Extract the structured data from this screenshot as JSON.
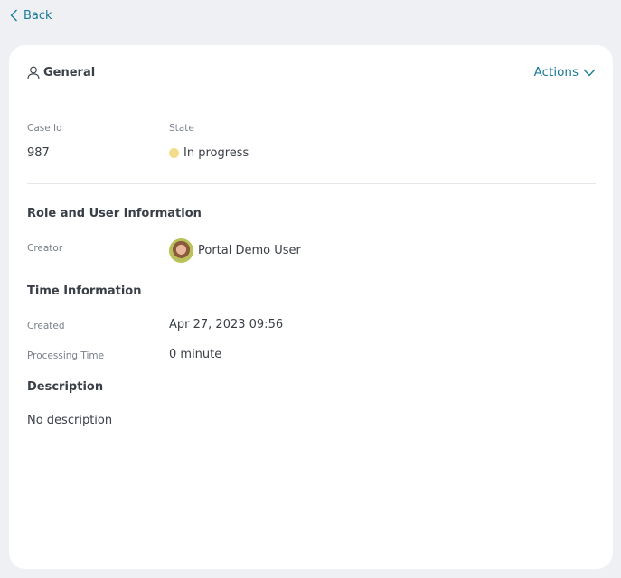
{
  "nav": {
    "back_label": "Back"
  },
  "card": {
    "title": "General",
    "actions_label": "Actions",
    "case_id": {
      "label": "Case Id",
      "value": "987"
    },
    "state": {
      "label": "State",
      "value": "In progress",
      "dot_color": "#f3dc8a"
    },
    "role_section": {
      "title": "Role and User Information",
      "creator_label": "Creator",
      "creator_name": "Portal Demo User"
    },
    "time_section": {
      "title": "Time Information",
      "created_label": "Created",
      "created_value": "Apr 27, 2023 09:56",
      "processing_label": "Processing Time",
      "processing_value": "0 minute"
    },
    "description_section": {
      "title": "Description",
      "value": "No description"
    }
  },
  "colors": {
    "accent": "#1b7a96",
    "background": "#eef0f3",
    "card": "#ffffff"
  }
}
